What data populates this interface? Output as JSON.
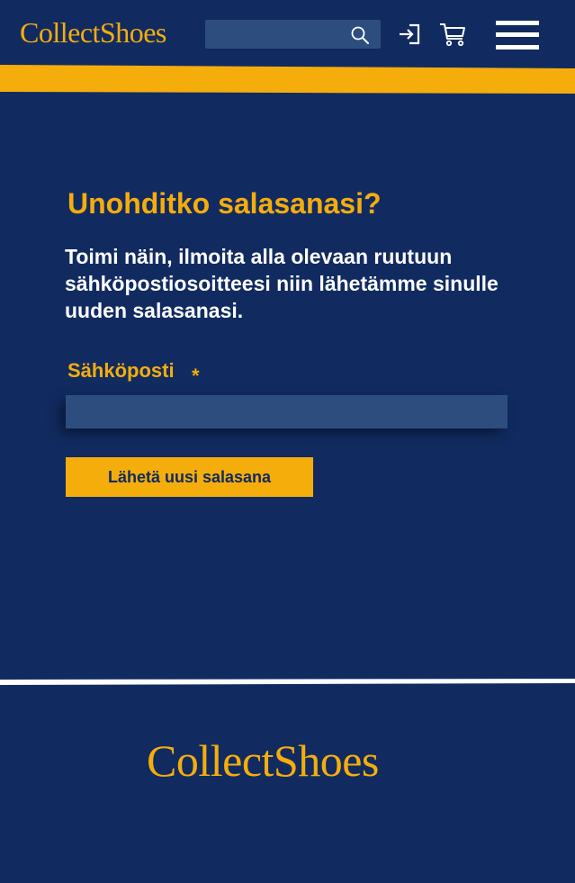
{
  "header": {
    "logo": "CollectShoes",
    "search": {
      "value": "",
      "placeholder": ""
    },
    "icons": {
      "search": "search-icon",
      "login": "login-icon",
      "cart": "cart-icon",
      "menu": "menu-icon"
    }
  },
  "main": {
    "title": "Unohditko salasanasi?",
    "instructions": "Toimi näin, ilmoita alla olevaan ruutuun sähköpostiosoitteesi niin lähetämme sinulle uuden salasanasi.",
    "email_field": {
      "label": "Sähköposti",
      "required_marker": "*",
      "value": "",
      "placeholder": ""
    },
    "submit_label": "Lähetä uusi salasana"
  },
  "footer": {
    "logo": "CollectShoes"
  },
  "colors": {
    "background": "#112b61",
    "accent": "#f5ad0c",
    "input_background": "#2d4d7f",
    "divider": "#ffffff",
    "text": "#ffffff"
  }
}
